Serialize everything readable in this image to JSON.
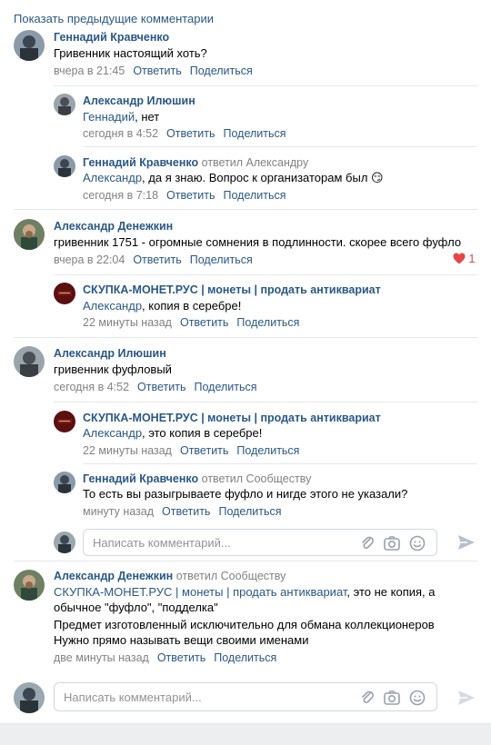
{
  "show_previous": "Показать предыдущие комментарии",
  "comments": [
    {
      "author": "Геннадий Кравченко",
      "reply_to": "",
      "text": "Гривенник настоящий хоть?",
      "time": "вчера в 21:45",
      "reply": "Ответить",
      "share": "Поделиться"
    },
    {
      "author": "Александр Илюшин",
      "reply_to": "",
      "mention": "Геннадий",
      "text": ", нет",
      "time": "сегодня в 4:52",
      "reply": "Ответить",
      "share": "Поделиться"
    },
    {
      "author": "Геннадий Кравченко",
      "reply_to": "ответил Александру",
      "mention": "Александр",
      "text": ", да я знаю. Вопрос к организаторам был 😏",
      "time": "сегодня в 7:18",
      "reply": "Ответить",
      "share": "Поделиться"
    },
    {
      "author": "Александр Денежкин",
      "reply_to": "",
      "text": "гривенник 1751 - огромные сомнения в подлинности. скорее всего фуфло",
      "time": "вчера в 22:04",
      "reply": "Ответить",
      "share": "Поделиться",
      "likes": "1"
    },
    {
      "author": "СКУПКА-МОНЕТ.РУС | монеты | продать антиквариат",
      "reply_to": "",
      "mention": "Александр",
      "text": ", копия в серебре!",
      "time": "22 минуты назад",
      "reply": "Ответить",
      "share": "Поделиться"
    },
    {
      "author": "Александр Илюшин",
      "reply_to": "",
      "text": "гривенник фуфловый",
      "time": "сегодня в 4:52",
      "reply": "Ответить",
      "share": "Поделиться"
    },
    {
      "author": "СКУПКА-МОНЕТ.РУС | монеты | продать антиквариат",
      "reply_to": "",
      "mention": "Александр",
      "text": ", это копия в серебре!",
      "time": "22 минуты назад",
      "reply": "Ответить",
      "share": "Поделиться"
    },
    {
      "author": "Геннадий Кравченко",
      "reply_to": "ответил Сообществу",
      "text": "То есть вы разыгрываете фуфло и нигде этого не указали?",
      "time": "минуту назад",
      "reply": "Ответить",
      "share": "Поделиться"
    },
    {
      "author": "Александр Денежкин",
      "reply_to": "ответил Сообществу",
      "mention": "СКУПКА-МОНЕТ.РУС | монеты | продать антиквариат",
      "text_line1": ", это не копия, а",
      "text_line2": "обычное \"фуфло\", \"подделка\"",
      "text_line3": "Предмет изготовленный исключительно для обмана коллекционеров",
      "text_line4": "Нужно прямо называть вещи своими именами",
      "time": "две минуты назад",
      "reply": "Ответить",
      "share": "Поделиться"
    }
  ],
  "reply_input": {
    "placeholder": "Написать комментарий..."
  },
  "main_input": {
    "placeholder": "Написать комментарий..."
  },
  "colors": {
    "link": "#2a5885",
    "meta": "#828282",
    "like": "#e64646",
    "separator": "#e7e8ec"
  }
}
